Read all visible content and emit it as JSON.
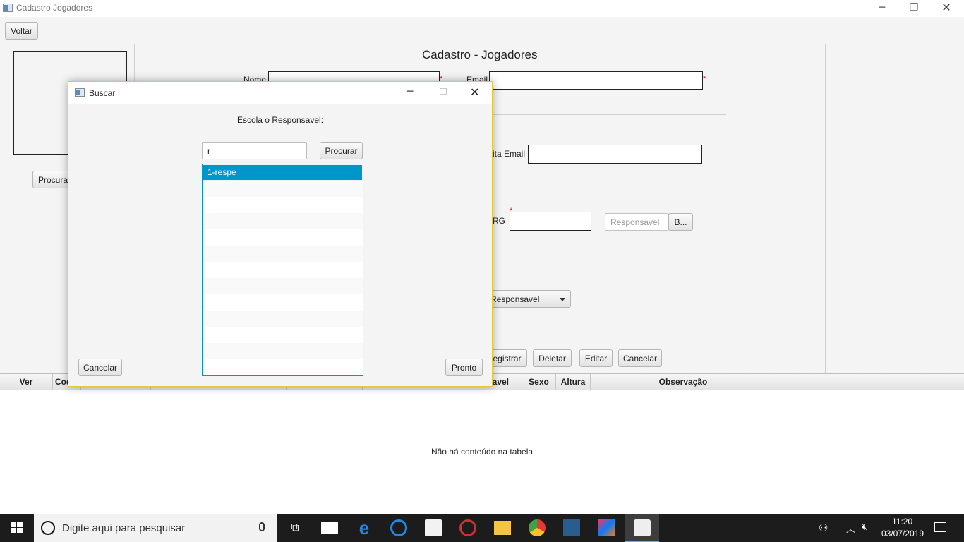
{
  "window": {
    "title": "Cadastro Jogadores"
  },
  "toolbar": {
    "back_label": "Voltar"
  },
  "form": {
    "title": "Cadastro - Jogadores",
    "name_label": "Nome",
    "email_label": "Email",
    "confirm_email_label": "ita Email",
    "rg_label": "RG",
    "photo_button": "Procura",
    "responsavel_placeholder": "Responsavel",
    "responsavel_button": "B...",
    "combo_value": "Responsavel",
    "actions": {
      "register": "egistrar",
      "delete": "Deletar",
      "edit": "Editar",
      "cancel": "Cancelar"
    }
  },
  "table": {
    "columns": [
      "Ver",
      "Codig",
      "",
      "",
      "",
      "",
      "avel",
      "Sexo",
      "Altura",
      "Observação"
    ],
    "empty_message": "Não há conteúdo na tabela"
  },
  "dialog": {
    "title": "Buscar",
    "prompt": "Escola o Responsavel:",
    "search_value": "r",
    "search_button": "Procurar",
    "items": [
      "1-respe"
    ],
    "cancel_button": "Cancelar",
    "done_button": "Pronto"
  },
  "taskbar": {
    "search_placeholder": "Digite aqui para pesquisar",
    "time": "11:20",
    "date": "03/07/2019"
  },
  "colors": {
    "accent": "#0096c9",
    "taskbar": "#1c1c1c",
    "required": "#e00000"
  }
}
